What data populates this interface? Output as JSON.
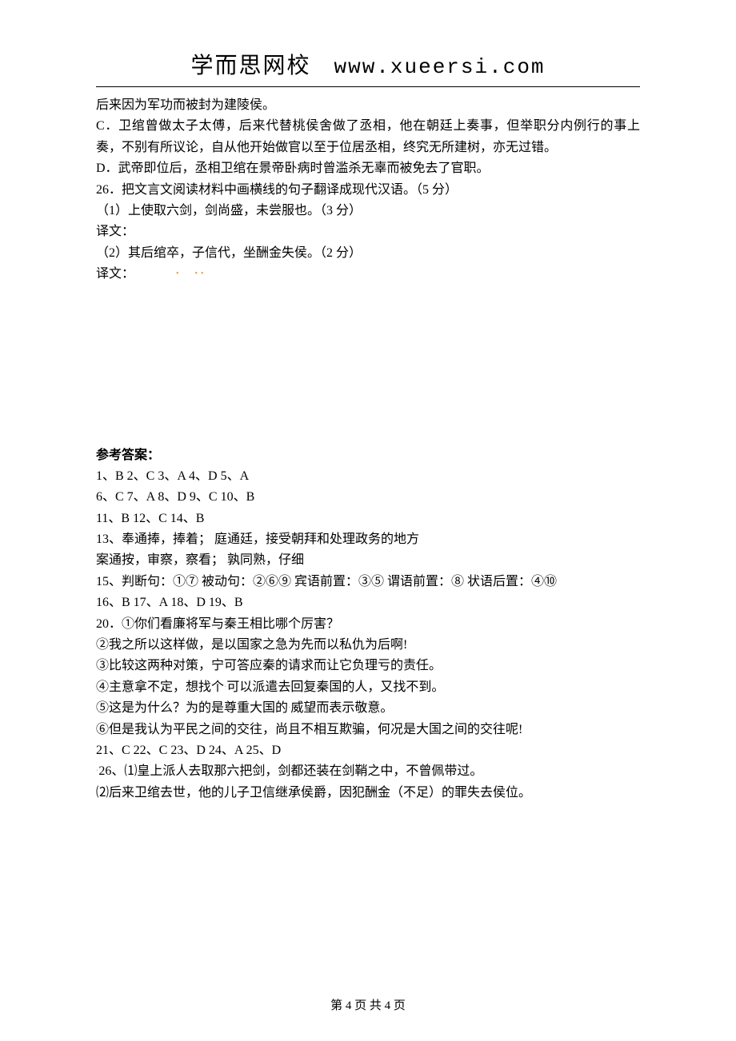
{
  "header": {
    "brand": "学而思网校",
    "url": "www.xueersi.com"
  },
  "questions": {
    "line1": "后来因为军功而被封为建陵侯。",
    "optC": "C．卫绾曾做太子太傅，后来代替桃侯舍做了丞相，他在朝廷上奏事，但举职分内例行的事上奏，不别有所议论，自从他开始做官以至于位居丞相，终究无所建树，亦无过错。",
    "optD": "D．武帝即位后，丞相卫绾在景帝卧病时曾滥杀无辜而被免去了官职。",
    "q26": "26．把文言文阅读材料中画横线的句子翻译成现代汉语。（5 分）",
    "q26_1": "（1）上使取六剑，剑尚盛，未尝服也。（3 分）",
    "q26_1_label": "译文：",
    "q26_2": "（2）其后绾卒，子信代，坐酬金失侯。（2 分）",
    "q26_2_label": "译文："
  },
  "answers": {
    "title": "参考答案：",
    "line1": " 1、B   2、C   3、A   4、D   5、A",
    "line2": " 6、C   7、A   8、D   9、C   10、B",
    "line3": " 11、B  12、C  14、B",
    "line4": " 13、奉通捧，捧着；      庭通廷，接受朝拜和处理政务的地方",
    "line5": "案通按，审察，察看；  孰同熟，仔细",
    "line6": " 15、判断句：①⑦ 被动句：②⑥⑨  宾语前置：③⑤  谓语前置：⑧  状语后置：④⑩",
    "line7": " 16、B 17、A 18、D 19、B",
    "line8": " 20．①你们看廉将军与秦王相比哪个厉害？",
    "line9": "②我之所以这样做，是以国家之急为先而以私仇为后啊!",
    "line10": "③比较这两种对策，宁可答应秦的请求而让它负理亏的责任。",
    "line11": "④主意拿不定，想找个可以派遣去回复秦国的人，又找不到。",
    "line12": "⑤这是为什么？为的是尊重大国的威望而表示敬意。",
    "line13": "⑥但是我认为平民之间的交往，尚且不相互欺骗，何况是大国之间的交往呢!",
    "line14": " 21、C 22、C 23、D 24、A 25、D",
    "line15": " 26、⑴皇上派人去取那六把剑，剑都还装在剑鞘之中，不曾佩带过。",
    "line16": "⑵后来卫绾去世，他的儿子卫信继承侯爵，因犯酬金（不足）的罪失去侯位。"
  },
  "footer": {
    "text": "第 4 页 共 4 页"
  }
}
